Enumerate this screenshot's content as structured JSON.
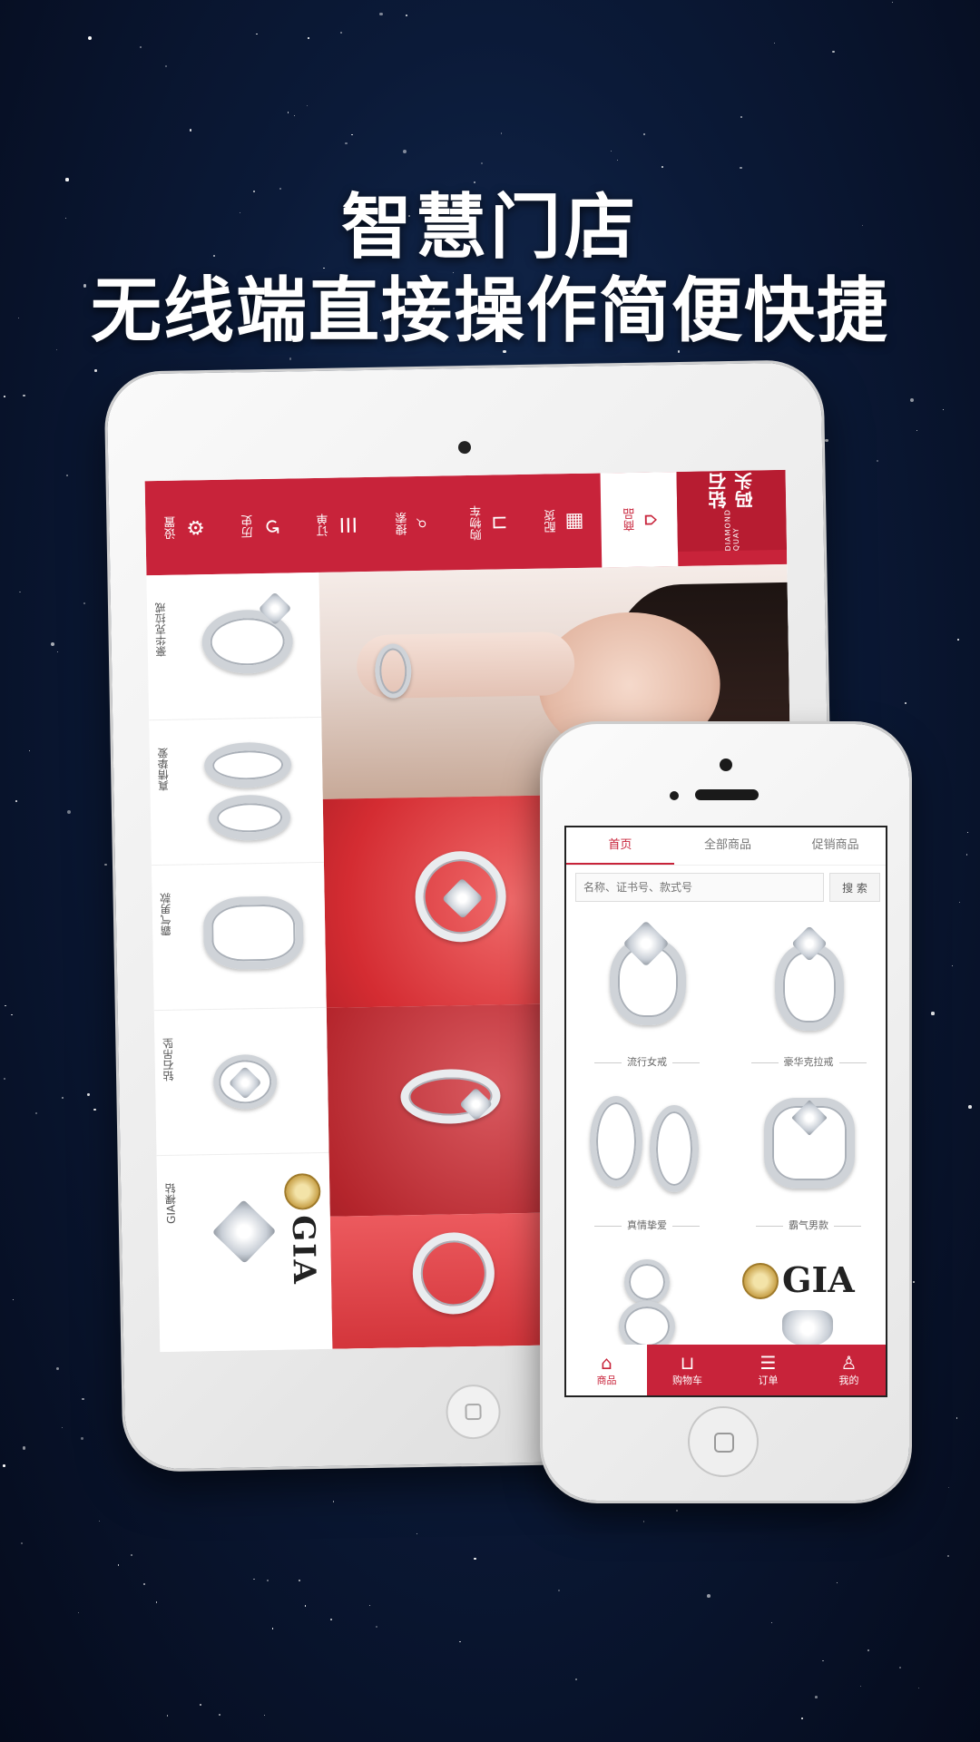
{
  "headline": {
    "line1": "智慧门店",
    "line2": "无线端直接操作简便快捷"
  },
  "tablet": {
    "logo_cn": "钻石码头",
    "logo_en": "DIAMOND QUAY",
    "nav": [
      {
        "label": "设置",
        "icon": "gear-icon",
        "glyph": "⚙"
      },
      {
        "label": "历史",
        "icon": "history-icon",
        "glyph": "↺"
      },
      {
        "label": "订单",
        "icon": "order-icon",
        "glyph": "☰"
      },
      {
        "label": "搜索",
        "icon": "search-icon",
        "glyph": "⌕"
      },
      {
        "label": "购物车",
        "icon": "cart-icon",
        "glyph": "⊔"
      },
      {
        "label": "配货",
        "icon": "grid-icon",
        "glyph": "▦"
      },
      {
        "label": "商品",
        "icon": "bag-icon",
        "glyph": "⌂"
      }
    ],
    "categories": [
      "豪华克拉戒",
      "真情挚爱",
      "霸气男款",
      "钻石吊坠",
      "GIA裸钻"
    ],
    "gia_text": "GIA"
  },
  "phone": {
    "tabs": [
      "首页",
      "全部商品",
      "促销商品"
    ],
    "search_placeholder": "名称、证书号、款式号",
    "search_button": "搜 索",
    "products": [
      "流行女戒",
      "豪华克拉戒",
      "真情挚爱",
      "霸气男款"
    ],
    "gia_text": "GIA",
    "bottom_nav": [
      {
        "label": "商品",
        "icon": "bag-icon",
        "glyph": "⌂"
      },
      {
        "label": "购物车",
        "icon": "cart-icon",
        "glyph": "⊔"
      },
      {
        "label": "订单",
        "icon": "order-icon",
        "glyph": "☰"
      },
      {
        "label": "我的",
        "icon": "user-icon",
        "glyph": "♙"
      }
    ]
  }
}
